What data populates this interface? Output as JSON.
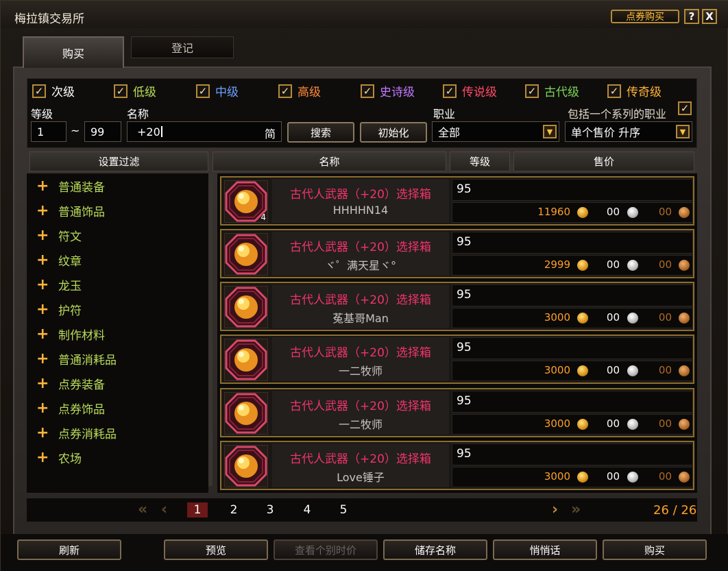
{
  "window": {
    "title": "梅拉镇交易所",
    "cash_shop_label": "点券购买",
    "help_label": "?",
    "close_label": "X"
  },
  "tabs": [
    {
      "label": "购买",
      "active": true
    },
    {
      "label": "登记",
      "active": false
    }
  ],
  "rarity_filters": [
    {
      "label": "次级",
      "color": "#ffffff",
      "checked": true
    },
    {
      "label": "低级",
      "color": "#b8dc5a",
      "checked": true
    },
    {
      "label": "中级",
      "color": "#6aa0ff",
      "checked": true
    },
    {
      "label": "高级",
      "color": "#ff8a3a",
      "checked": true
    },
    {
      "label": "史诗级",
      "color": "#c07aff",
      "checked": true
    },
    {
      "label": "传说级",
      "color": "#ff4a6a",
      "checked": true
    },
    {
      "label": "古代级",
      "color": "#7ad85a",
      "checked": true
    },
    {
      "label": "传奇级",
      "color": "#ffb43a",
      "checked": true
    }
  ],
  "search": {
    "level_label": "等级",
    "level_min": "1",
    "level_sep": "~",
    "level_max": "99",
    "name_label": "名称",
    "name_value": "+20",
    "ime_indicator": "简",
    "search_button": "搜索",
    "reset_button": "初始化",
    "job_label": "职业",
    "job_value": "全部",
    "series_label": "包括一个系列的职业",
    "series_checked": true,
    "sort_value": "单个售价 升序"
  },
  "headers": {
    "filter": "设置过滤",
    "name": "名称",
    "level": "等级",
    "price": "售价"
  },
  "categories": [
    "普通装备",
    "普通饰品",
    "符文",
    "纹章",
    "龙玉",
    "护符",
    "制作材料",
    "普通消耗品",
    "点券装备",
    "点券饰品",
    "点券消耗品",
    "农场"
  ],
  "listings": [
    {
      "name": "古代人武器（+20）选择箱",
      "seller": "HHHHN14",
      "level": "95",
      "gold": "11960",
      "silver": "00",
      "copper": "00",
      "qty": "4"
    },
    {
      "name": "古代人武器（+20）选择箱",
      "seller": "ヾ゜满天星ヾ°",
      "level": "95",
      "gold": "2999",
      "silver": "00",
      "copper": "00",
      "qty": ""
    },
    {
      "name": "古代人武器（+20）选择箱",
      "seller": "菟基哥Man",
      "level": "95",
      "gold": "3000",
      "silver": "00",
      "copper": "00",
      "qty": ""
    },
    {
      "name": "古代人武器（+20）选择箱",
      "seller": "一二牧师",
      "level": "95",
      "gold": "3000",
      "silver": "00",
      "copper": "00",
      "qty": ""
    },
    {
      "name": "古代人武器（+20）选择箱",
      "seller": "一二牧师",
      "level": "95",
      "gold": "3000",
      "silver": "00",
      "copper": "00",
      "qty": ""
    },
    {
      "name": "古代人武器（+20）选择箱",
      "seller": "Love锤子",
      "level": "95",
      "gold": "3000",
      "silver": "00",
      "copper": "00",
      "qty": ""
    }
  ],
  "pagination": {
    "pages": [
      "1",
      "2",
      "3",
      "4",
      "5"
    ],
    "current": "1",
    "count": "26 / 26"
  },
  "bottom_buttons": [
    {
      "label": "刷新",
      "enabled": true
    },
    {
      "label": "预览",
      "enabled": true
    },
    {
      "label": "查看个别时价",
      "enabled": false
    },
    {
      "label": "储存名称",
      "enabled": true
    },
    {
      "label": "悄悄话",
      "enabled": true
    },
    {
      "label": "购买",
      "enabled": true
    }
  ]
}
